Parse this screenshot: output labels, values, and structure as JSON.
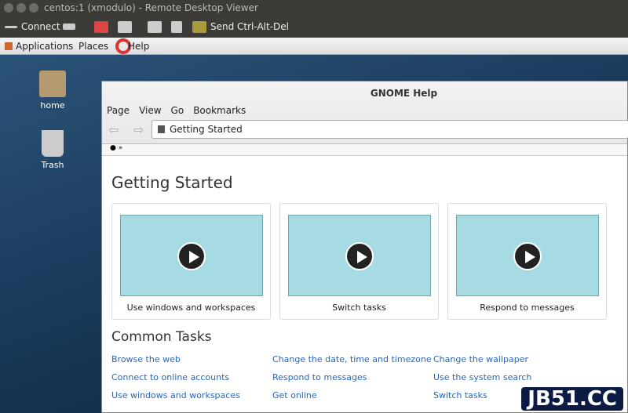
{
  "titlebar": {
    "title": "centos:1 (xmodulo) - Remote Desktop Viewer"
  },
  "toolbar": {
    "connect": "Connect",
    "send_cad": "Send Ctrl-Alt-Del"
  },
  "panel": {
    "applications": "Applications",
    "places": "Places",
    "help": "Help"
  },
  "desktop": {
    "icons": [
      {
        "label": "home"
      },
      {
        "label": "Trash"
      }
    ]
  },
  "window": {
    "title": "GNOME Help",
    "menu": [
      "Page",
      "View",
      "Go",
      "Bookmarks"
    ],
    "location": "Getting Started",
    "breadcrumb": "»"
  },
  "page": {
    "heading": "Getting Started",
    "cards": [
      "Use windows and workspaces",
      "Switch tasks",
      "Respond to messages"
    ],
    "common_heading": "Common Tasks",
    "links": [
      "Browse the web",
      "Change the date, time and timezone",
      "Change the wallpaper",
      "Connect to online accounts",
      "Respond to messages",
      "Use the system search",
      "Use windows and workspaces",
      "Get online",
      "Switch tasks"
    ]
  },
  "watermark": "JB51.CC"
}
